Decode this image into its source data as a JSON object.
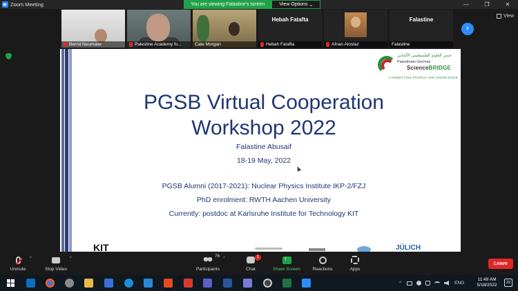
{
  "window": {
    "title": "Zoom Meeting",
    "share_banner": "You are viewing Falastine's screen",
    "view_options": "View Options",
    "view_options_caret": "⌄",
    "minimize": "—",
    "maximize": "❐",
    "close": "✕"
  },
  "thumbnails": [
    {
      "name": "Bernd Neumaier",
      "muted": true
    },
    {
      "name": "Palestine Academy fo...",
      "muted": true
    },
    {
      "name": "Cate Morgan",
      "muted": false
    },
    {
      "name": "Hebah Fatafta",
      "display": "Hebah Fatafta",
      "muted": true
    },
    {
      "name": "Afnan Alostaz",
      "muted": true
    },
    {
      "name": "Falastine",
      "display": "Falastine",
      "muted": false
    }
  ],
  "strip": {
    "next": "›",
    "view_label": "View"
  },
  "slide": {
    "logo": {
      "arabic": "جسر العلوم الفلسطيني الألماني",
      "german": "Palestinian-German",
      "science": "Science",
      "bridge": "BRIDGE",
      "tagline": "CONNECTING PEOPLE AND KNOWLEDGE"
    },
    "title_line1": "PGSB Virtual Cooperation",
    "title_line2": "Workshop 2022",
    "presenter": "Falastine Abusaif",
    "dates": "18-19 May, 2022",
    "alumni": "PGSB Alumni (2017-2021): Nuclear Physics Institute IKP-2/FZJ",
    "phd": "PhD enrolment: RWTH Aachen University",
    "current": "Currently: postdoc at Karlsruhe Institute for Technology KIT",
    "footer_kit": "KIT",
    "footer_julich": "JÜLICH"
  },
  "toolbar": {
    "unmute": "Unmute",
    "stop_video": "Stop Video",
    "participants": "Participants",
    "participants_count": "76",
    "chat": "Chat",
    "chat_badge": "1",
    "share_screen": "Share Screen",
    "reactions": "Reactions",
    "apps": "Apps",
    "leave": "Leave",
    "caret": "^"
  },
  "taskbar": {
    "language": "ENG",
    "time": "11:49 AM",
    "date": "5/18/2022",
    "notifications": "22",
    "tray_caret": "^"
  },
  "colors": {
    "zoom_blue": "#2d8cff",
    "share_green": "#21a249",
    "leave_red": "#e02828",
    "slide_title": "#1f3573"
  }
}
